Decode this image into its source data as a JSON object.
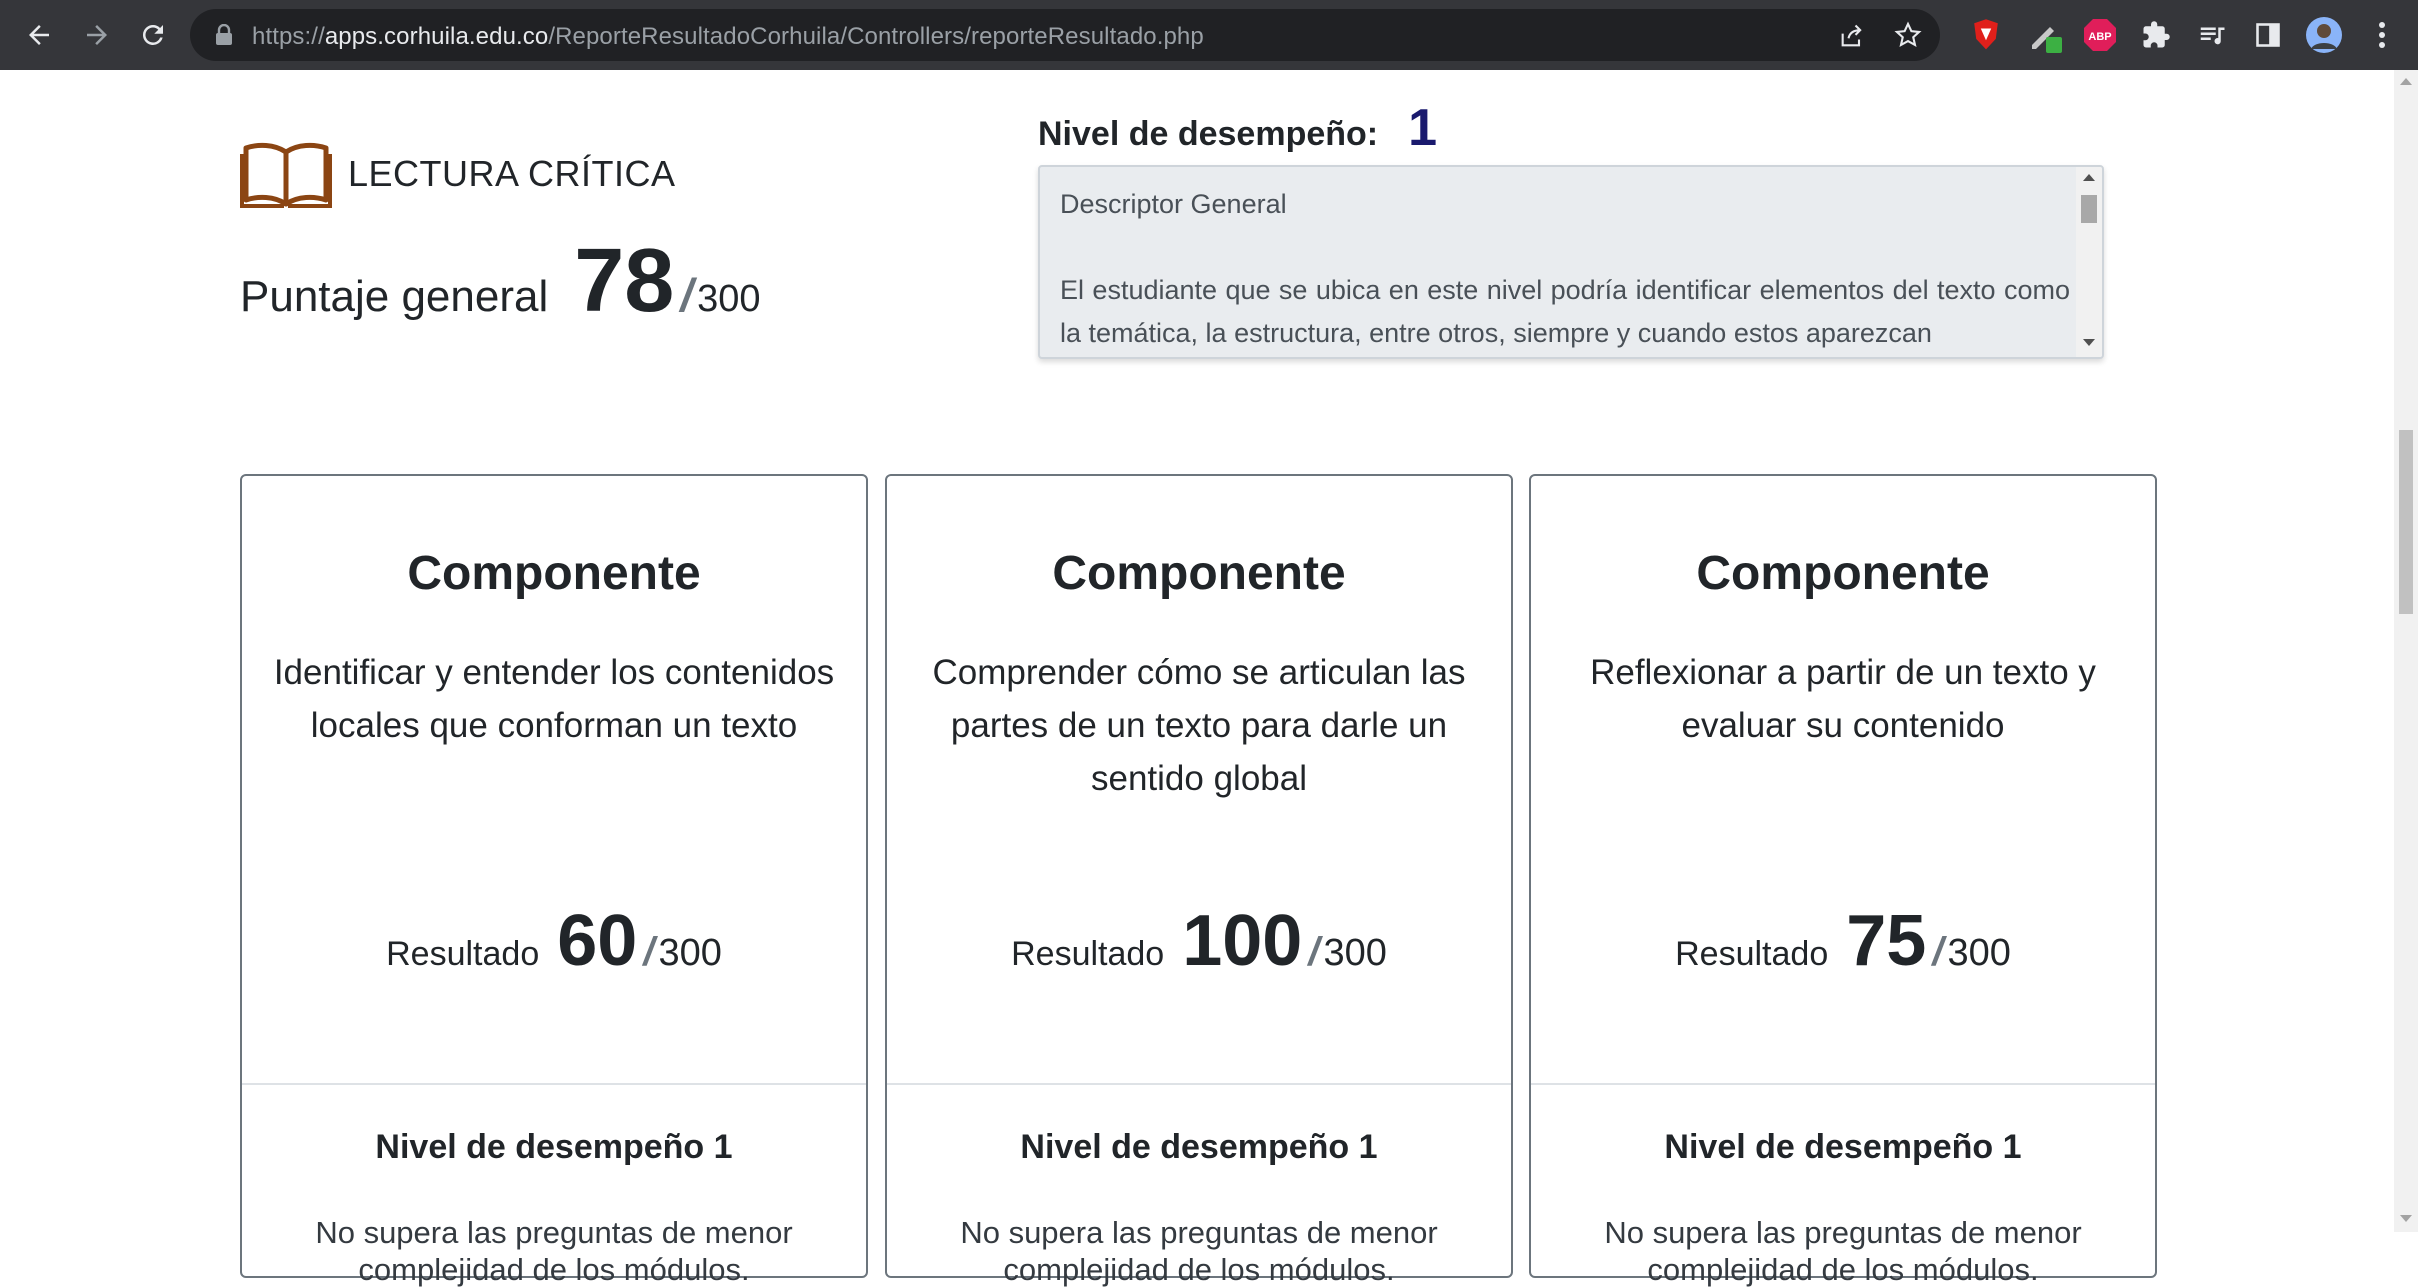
{
  "browser": {
    "url_prefix": "https://",
    "url_host": "apps.corhuila.edu.co",
    "url_path": "/ReporteResultadoCorhuila/Controllers/reporteResultado.php",
    "extensions": [
      "brave-shield-icon",
      "pen-extension-icon",
      "adblock-icon",
      "puzzle-icon",
      "media-list-icon",
      "side-panel-icon",
      "profile-avatar",
      "menu-icon"
    ],
    "abp_label": "ABP"
  },
  "module": {
    "name": "LECTURA CRÍTICA",
    "icon": "open-book-icon",
    "general_label": "Puntaje general",
    "general_score": "78",
    "general_max": "300",
    "slash": "/"
  },
  "level": {
    "label": "Nivel de desempeño:",
    "value": "1"
  },
  "descriptor": {
    "title": "Descriptor General",
    "body": "El estudiante que se ubica en este nivel podría identificar elementos del texto como la temática, la estructura, entre otros, siempre y cuando estos aparezcan"
  },
  "cards": [
    {
      "title": "Componente",
      "description": "Identificar y entender los contenidos locales que conforman un texto",
      "result_label": "Resultado",
      "result_value": "60",
      "result_max": "300",
      "level_title": "Nivel de desempeño 1",
      "level_note": "No supera las preguntas de menor complejidad de los módulos."
    },
    {
      "title": "Componente",
      "description": "Comprender cómo se articulan las partes de un texto para darle un sentido global",
      "result_label": "Resultado",
      "result_value": "100",
      "result_max": "300",
      "level_title": "Nivel de desempeño 1",
      "level_note": "No supera las preguntas de menor complejidad de los módulos."
    },
    {
      "title": "Componente",
      "description": "Reflexionar a partir de un texto y evaluar su contenido",
      "result_label": "Resultado",
      "result_value": "75",
      "result_max": "300",
      "level_title": "Nivel de desempeño 1",
      "level_note": "No supera las preguntas de menor complejidad de los módulos."
    }
  ],
  "colors": {
    "chrome_bg": "#35363a",
    "omnibox_bg": "#202124",
    "level_value": "#1a1a6e",
    "book_icon": "#8b4513"
  }
}
